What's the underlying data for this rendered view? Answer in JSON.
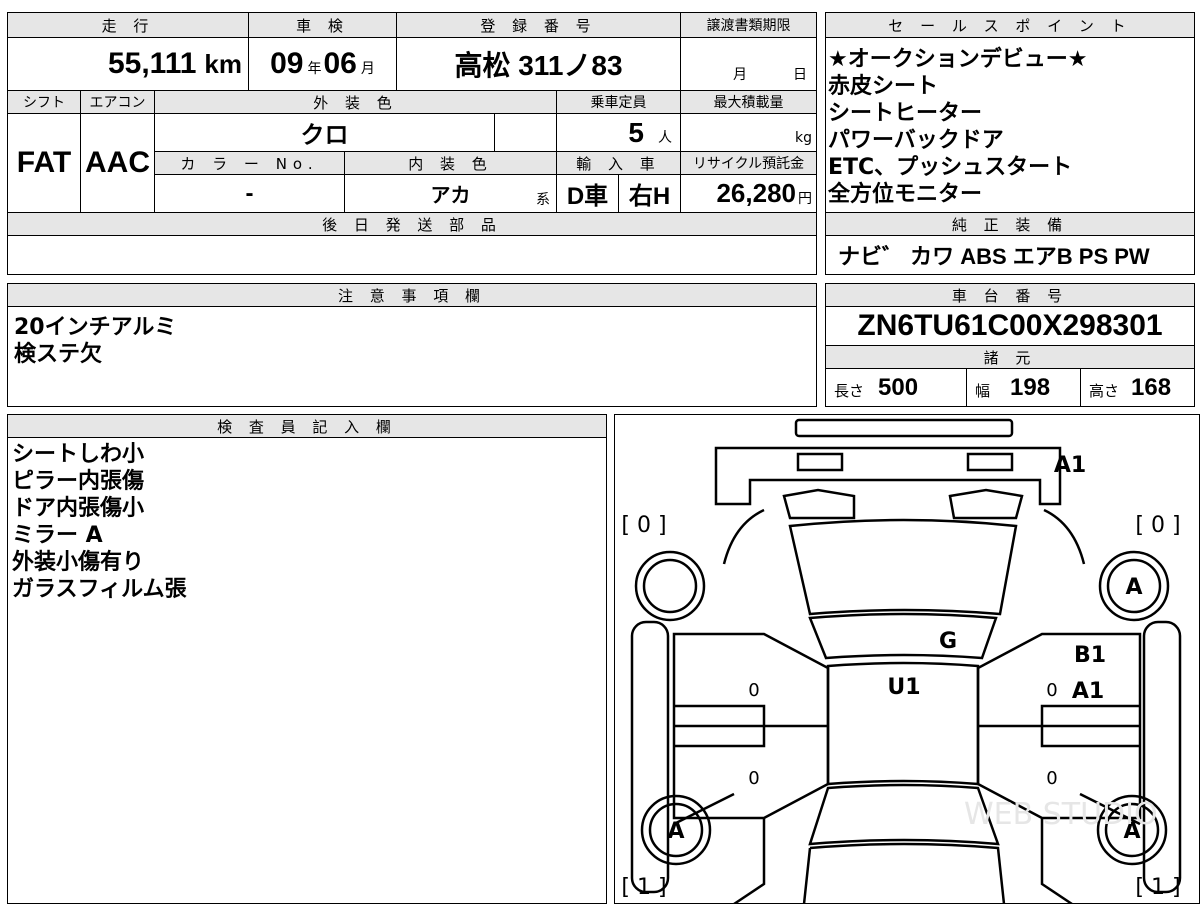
{
  "headers": {
    "mileage": "走 行",
    "shaken": "車 検",
    "registration": "登 録 番 号",
    "transfer_deadline": "譲渡書類期限",
    "sales_point": "セ ー ル ス ポ イ ン ト",
    "shift": "シフト",
    "aircon": "エアコン",
    "exterior_color": "外 装 色",
    "capacity": "乗車定員",
    "max_load": "最大積載量",
    "color_no": "カ ラ ー No.",
    "interior_color": "内 装 色",
    "import": "輸 入 車",
    "recycle": "リサイクル預託金",
    "later_parts": "後 日 発 送 部 品",
    "genuine_equipment": "純 正 装 備",
    "notes": "注 意 事 項 欄",
    "chassis": "車 台 番 号",
    "specs": "諸 元",
    "inspector": "検 査 員 記 入 欄"
  },
  "values": {
    "mileage": "55,111",
    "mileage_unit": "km",
    "shaken_year": "09",
    "year_unit": "年",
    "shaken_month": "06",
    "month_unit": "月",
    "registration": "高松 311ノ83",
    "transfer_month": "月",
    "transfer_day": "日",
    "shift": "FAT",
    "aircon": "AAC",
    "exterior_color": "クロ",
    "capacity": "5",
    "capacity_unit": "人",
    "max_load_unit": "kg",
    "color_no": "-",
    "interior_color": "アカ",
    "interior_suffix": "系",
    "import_type": "D車",
    "steering": "右H",
    "recycle": "26,280",
    "recycle_unit": "円",
    "genuine_equipment": "ナビ゛ カワ ABS エアB PS PW",
    "chassis": "ZN6TU61C00X298301",
    "length_label": "長さ",
    "length": "500",
    "width_label": "幅",
    "width": "198",
    "height_label": "高さ",
    "height": "168"
  },
  "sales_points": [
    "★オークションデビュー★",
    "赤皮シート",
    "シートヒーター",
    "パワーバックドア",
    "ETC、プッシュスタート",
    "全方位モニター"
  ],
  "notes": [
    "20インチアルミ",
    "検ステ欠"
  ],
  "inspector_notes": [
    "シートしわ小",
    "ピラー内張傷",
    "ドア内張傷小",
    "ミラー A",
    "外装小傷有り",
    "ガラスフィルム張"
  ],
  "diagram": {
    "mark_rear_top": "A1",
    "tire_tl": "[ 0 ]",
    "tire_tr": "[ 0 ]",
    "tire_bl": "[ 1 ]",
    "tire_br": "[ 1 ]",
    "wheel_tl": "",
    "wheel_tr": "A",
    "wheel_bl": "A",
    "wheel_br": "A",
    "mark_glass": "G",
    "mark_roof": "U1",
    "mark_right_door_1": "B1",
    "mark_right_door_2": "A1",
    "zero_left_upper": "0",
    "zero_left_lower": "0",
    "zero_right_upper": "0",
    "zero_right_lower": "0",
    "watermark": "WEB STUDIO"
  }
}
